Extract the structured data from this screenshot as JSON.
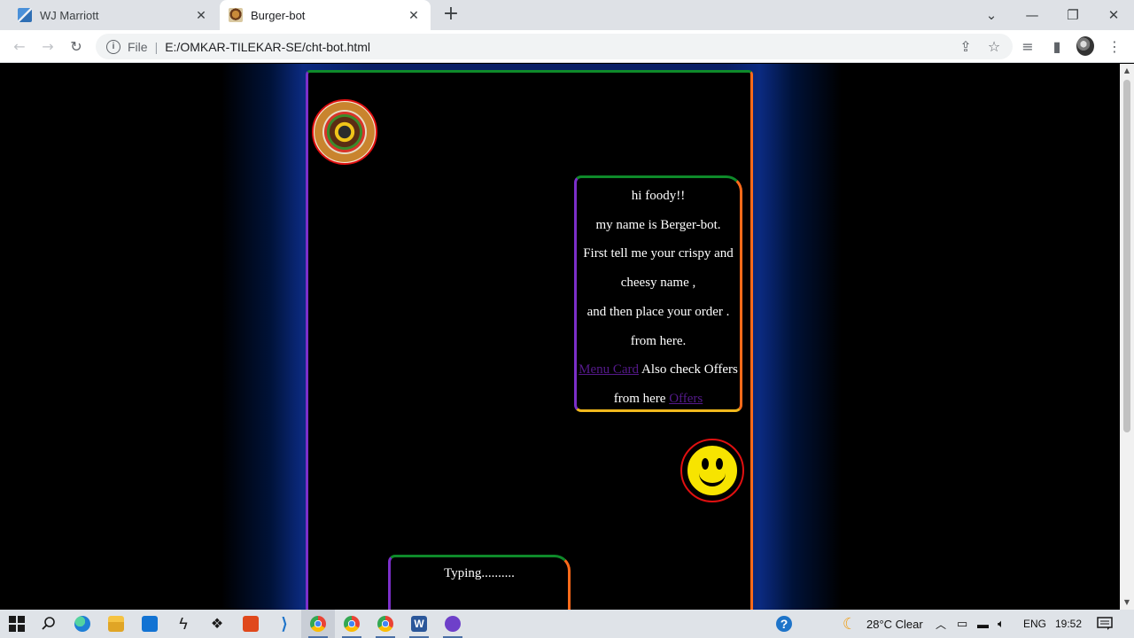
{
  "browser": {
    "tabs": [
      {
        "title": "WJ Marriott",
        "active": false
      },
      {
        "title": "Burger-bot",
        "active": true
      }
    ],
    "address": {
      "scheme": "File",
      "url": "E:/OMKAR-TILEKAR-SE/cht-bot.html"
    }
  },
  "chat": {
    "bot_message": {
      "lines": [
        "hi foody!!",
        "my name is Berger-bot.",
        "First tell me your crispy and",
        "cheesy name ,",
        "and then place your order .",
        "from here."
      ],
      "menu_link": "Menu Card",
      "offers_text": "Also check Offers",
      "from_here": "from here",
      "offers_link": "Offers"
    },
    "typing": "Typing.........."
  },
  "taskbar": {
    "weather": "28°C  Clear",
    "language": "ENG",
    "time": "19:52"
  },
  "colors": {
    "green_border": "#0e8a2a",
    "purple_border": "#7b2fc9",
    "orange_border": "#ff6a1a",
    "yellow_border": "#f0b81d",
    "glow_blue": "#0a1f66"
  }
}
